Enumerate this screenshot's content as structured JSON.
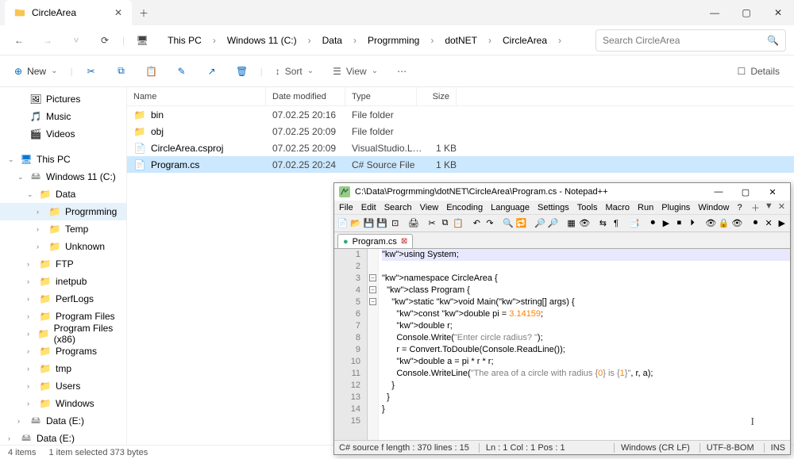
{
  "tab": {
    "title": "CircleArea"
  },
  "breadcrumb": [
    "This PC",
    "Windows 11 (C:)",
    "Data",
    "Progrmming",
    "dotNET",
    "CircleArea"
  ],
  "search": {
    "placeholder": "Search CircleArea"
  },
  "toolbar": {
    "new": "New",
    "sort": "Sort",
    "view": "View",
    "details": "Details"
  },
  "quickaccess": [
    {
      "name": "Pictures",
      "icon": "pictures"
    },
    {
      "name": "Music",
      "icon": "music"
    },
    {
      "name": "Videos",
      "icon": "videos"
    }
  ],
  "tree": [
    {
      "label": "This PC",
      "lvl": 0,
      "icon": "pc",
      "exp": true
    },
    {
      "label": "Windows 11 (C:)",
      "lvl": 1,
      "icon": "drive",
      "exp": true
    },
    {
      "label": "Data",
      "lvl": 2,
      "icon": "folder",
      "exp": true
    },
    {
      "label": "Progrmming",
      "lvl": 3,
      "icon": "folder",
      "sel": true
    },
    {
      "label": "Temp",
      "lvl": 3,
      "icon": "folder"
    },
    {
      "label": "Unknown",
      "lvl": 3,
      "icon": "folder"
    },
    {
      "label": "FTP",
      "lvl": 2,
      "icon": "folder"
    },
    {
      "label": "inetpub",
      "lvl": 2,
      "icon": "folder"
    },
    {
      "label": "PerfLogs",
      "lvl": 2,
      "icon": "folder"
    },
    {
      "label": "Program Files",
      "lvl": 2,
      "icon": "folder"
    },
    {
      "label": "Program Files (x86)",
      "lvl": 2,
      "icon": "folder"
    },
    {
      "label": "Programs",
      "lvl": 2,
      "icon": "folder"
    },
    {
      "label": "tmp",
      "lvl": 2,
      "icon": "folder"
    },
    {
      "label": "Users",
      "lvl": 2,
      "icon": "folder"
    },
    {
      "label": "Windows",
      "lvl": 2,
      "icon": "folder"
    },
    {
      "label": "Data (E:)",
      "lvl": 1,
      "icon": "drive"
    },
    {
      "label": "Data (E:)",
      "lvl": 0,
      "icon": "drive"
    }
  ],
  "columns": {
    "name": "Name",
    "date": "Date modified",
    "type": "Type",
    "size": "Size"
  },
  "files": [
    {
      "name": "bin",
      "date": "07.02.25 20:16",
      "type": "File folder",
      "size": "",
      "icon": "folder"
    },
    {
      "name": "obj",
      "date": "07.02.25 20:09",
      "type": "File folder",
      "size": "",
      "icon": "folder"
    },
    {
      "name": "CircleArea.csproj",
      "date": "07.02.25 20:09",
      "type": "VisualStudio.Laun...",
      "size": "1 KB",
      "icon": "proj"
    },
    {
      "name": "Program.cs",
      "date": "07.02.25 20:24",
      "type": "C# Source File",
      "size": "1 KB",
      "icon": "cs",
      "sel": true
    }
  ],
  "status": {
    "count": "4 items",
    "selection": "1 item selected  373 bytes"
  },
  "npp": {
    "title": "C:\\Data\\Progrmming\\dotNET\\CircleArea\\Program.cs - Notepad++",
    "menu": [
      "File",
      "Edit",
      "Search",
      "View",
      "Encoding",
      "Language",
      "Settings",
      "Tools",
      "Macro",
      "Run",
      "Plugins",
      "Window",
      "?"
    ],
    "tab": "Program.cs",
    "status": {
      "left": "C# source f length : 370    lines : 15",
      "pos": "Ln : 1    Col : 1    Pos : 1",
      "eol": "Windows (CR LF)",
      "enc": "UTF-8-BOM",
      "mode": "INS"
    },
    "code": [
      {
        "n": 1,
        "t": "using System;",
        "hl": true
      },
      {
        "n": 2,
        "t": ""
      },
      {
        "n": 3,
        "t": "namespace CircleArea {",
        "fold": true
      },
      {
        "n": 4,
        "t": "  class Program {",
        "fold": true
      },
      {
        "n": 5,
        "t": "    static void Main(string[] args) {",
        "fold": true
      },
      {
        "n": 6,
        "t": "      const double pi = 3.14159;"
      },
      {
        "n": 7,
        "t": "      double r;"
      },
      {
        "n": 8,
        "t": "      Console.Write(\"Enter circle radius? \");"
      },
      {
        "n": 9,
        "t": "      r = Convert.ToDouble(Console.ReadLine());"
      },
      {
        "n": 10,
        "t": "      double a = pi * r * r;"
      },
      {
        "n": 11,
        "t": "      Console.WriteLine(\"The area of a circle with radius {0} is {1}\", r, a);"
      },
      {
        "n": 12,
        "t": "    }"
      },
      {
        "n": 13,
        "t": "  }"
      },
      {
        "n": 14,
        "t": "}"
      },
      {
        "n": 15,
        "t": ""
      }
    ]
  }
}
